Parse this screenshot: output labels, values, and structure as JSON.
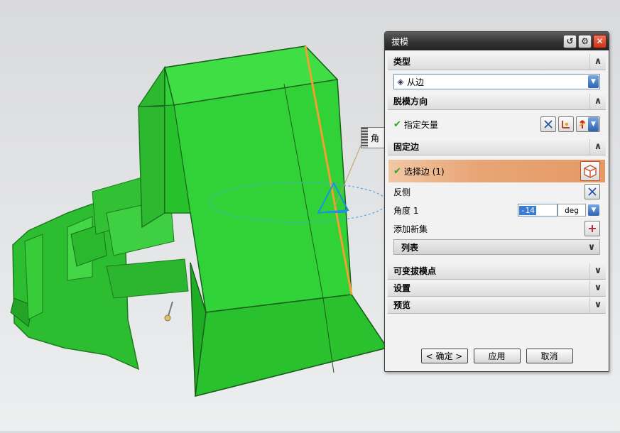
{
  "viewport": {
    "angle_tag_text": "角",
    "model_color": "#22c42e",
    "edge_highlight_color": "#f0a030"
  },
  "dialog": {
    "title": "拔模",
    "title_buttons": [
      "reset-icon",
      "gear-icon",
      "close-icon"
    ],
    "sections": {
      "type": {
        "header": "类型",
        "combo_value": "从边"
      },
      "draw_direction": {
        "header": "脱模方向",
        "label": "指定矢量"
      },
      "fixed_edge": {
        "header": "固定边",
        "select_edge_label": "选择边 (1)",
        "reverse_label": "反侧",
        "angle_label": "角度 1",
        "angle_value": "-14",
        "angle_unit": "deg",
        "add_set_label": "添加新集",
        "list_label": "列表"
      },
      "variable_points": {
        "header": "可变拔模点"
      },
      "settings": {
        "header": "设置"
      },
      "preview": {
        "header": "预览"
      }
    },
    "footer": {
      "ok": "< 确定 >",
      "apply": "应用",
      "cancel": "取消"
    }
  },
  "colors": {
    "title_bar": "#2f2f2f",
    "selected_row": "#e8a576",
    "check_green": "#2aa52a",
    "accent_blue": "#2c62b3"
  }
}
